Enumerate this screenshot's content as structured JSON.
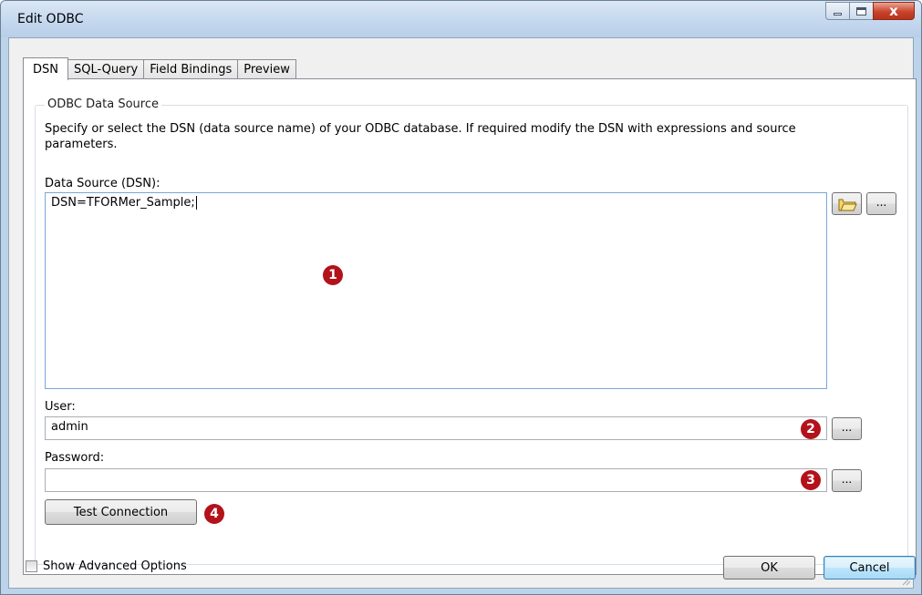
{
  "window": {
    "title": "Edit ODBC",
    "icons": [
      "minimize-icon",
      "maximize-icon",
      "close-icon"
    ],
    "close_glyph": "x"
  },
  "tabs": [
    {
      "label": "DSN",
      "active": true
    },
    {
      "label": "SQL-Query",
      "active": false
    },
    {
      "label": "Field Bindings",
      "active": false
    },
    {
      "label": "Preview",
      "active": false
    }
  ],
  "group": {
    "title": "ODBC Data Source",
    "description": "Specify or select the DSN (data source name) of your ODBC database. If required modify the DSN with expressions and source parameters."
  },
  "dsn": {
    "label": "Data Source (DSN):",
    "value": "DSN=TFORMer_Sample;",
    "browse_icon": "folder-open-icon",
    "ellipsis_label": "..."
  },
  "user": {
    "label": "User:",
    "value": "admin",
    "ellipsis_label": "..."
  },
  "password": {
    "label": "Password:",
    "value": "",
    "ellipsis_label": "..."
  },
  "test_connection_label": "Test Connection",
  "markers": [
    "1",
    "2",
    "3",
    "4"
  ],
  "marker_color": "#b3121b",
  "footer": {
    "show_advanced_label": "Show Advanced Options",
    "show_advanced_checked": false,
    "ok_label": "OK",
    "cancel_label": "Cancel"
  }
}
